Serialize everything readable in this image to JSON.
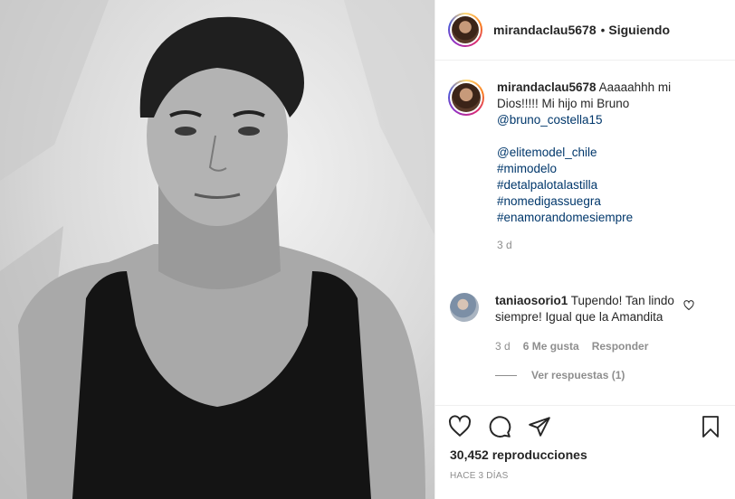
{
  "post": {
    "username": "mirandaclau5678",
    "separator": "•",
    "follow_status": "Siguiendo",
    "photo_icon": "portrait-photo"
  },
  "caption": {
    "username": "mirandaclau5678",
    "text": "Aaaaahhh mi Dios!!!!! Mi hijo mi Bruno",
    "mention": "@bruno_costella15",
    "tags": [
      "@elitemodel_chile",
      "#mimodelo",
      "#detalpalotalastilla",
      "#nomedigassuegra",
      "#enamorandomesiempre"
    ],
    "time": "3 d"
  },
  "comment": {
    "username": "taniaosorio1",
    "text": "Tupendo! Tan lindo siempre! Igual que la Amandita",
    "time": "3 d",
    "likes": "6 Me gusta",
    "reply_label": "Responder",
    "view_replies": "Ver respuestas (1)"
  },
  "actions": {
    "views": "30,452 reproducciones",
    "posted_ago": "HACE 3 DÍAS"
  },
  "icons": [
    "heart-icon",
    "comment-icon",
    "share-icon",
    "bookmark-icon"
  ]
}
